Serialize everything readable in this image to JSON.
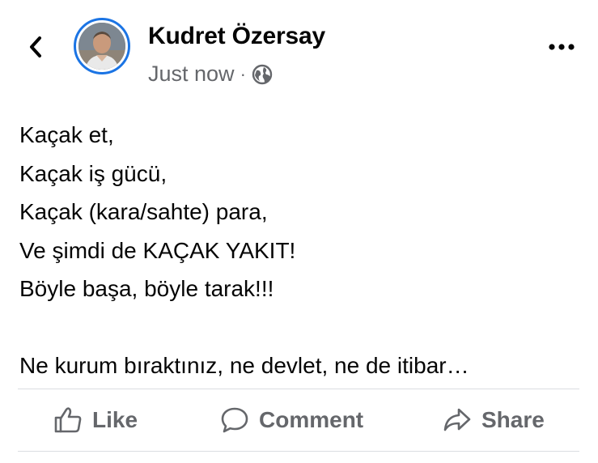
{
  "header": {
    "author_name": "Kudret Özersay",
    "timestamp": "Just now",
    "separator": "·",
    "audience_icon": "globe-icon",
    "back_icon": "chevron-left-icon",
    "more_icon": "more-dots-icon"
  },
  "post": {
    "lines": [
      "Kaçak et,",
      "Kaçak iş gücü,",
      "Kaçak (kara/sahte) para,",
      "Ve şimdi de KAÇAK YAKIT!",
      "Böyle başa, böyle tarak!!!",
      "",
      "Ne kurum bıraktınız, ne devlet, ne de itibar…"
    ]
  },
  "actions": {
    "like_label": "Like",
    "comment_label": "Comment",
    "share_label": "Share"
  },
  "colors": {
    "accent": "#1b74e4",
    "secondary_text": "#65676b",
    "primary_text": "#050505",
    "divider": "#dadde1"
  }
}
